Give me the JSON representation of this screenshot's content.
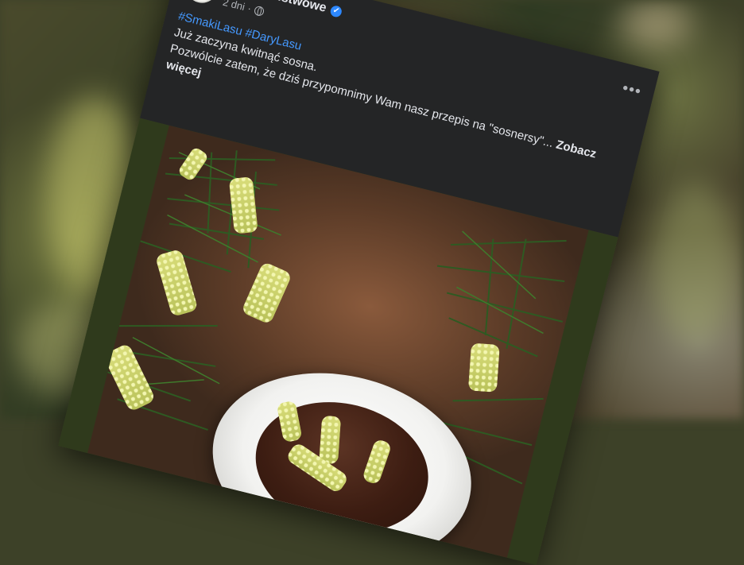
{
  "post": {
    "page_name": "Lasy Państwowe",
    "time": "2 dni",
    "separator": "·",
    "hashtags": [
      "#SmakiLasu",
      "#DaryLasu"
    ],
    "text_lines": [
      "Już zaczyna kwitnąć sosna.",
      "Pozwólcie zatem, że dziś przypomnimy Wam nasz  przepis na \"sosnersy\"..."
    ],
    "see_more": "Zobacz więcej",
    "more_options": "•••"
  },
  "icons": {
    "avatar": "lasy-panstwowe-logo",
    "verified": "verified-badge-icon",
    "audience": "globe-icon",
    "options": "more-options-icon"
  },
  "colors": {
    "card_bg": "#242526",
    "text": "#e4e6eb",
    "secondary_text": "#b0b3b8",
    "link": "#4599ff",
    "verified": "#2d88ff"
  }
}
